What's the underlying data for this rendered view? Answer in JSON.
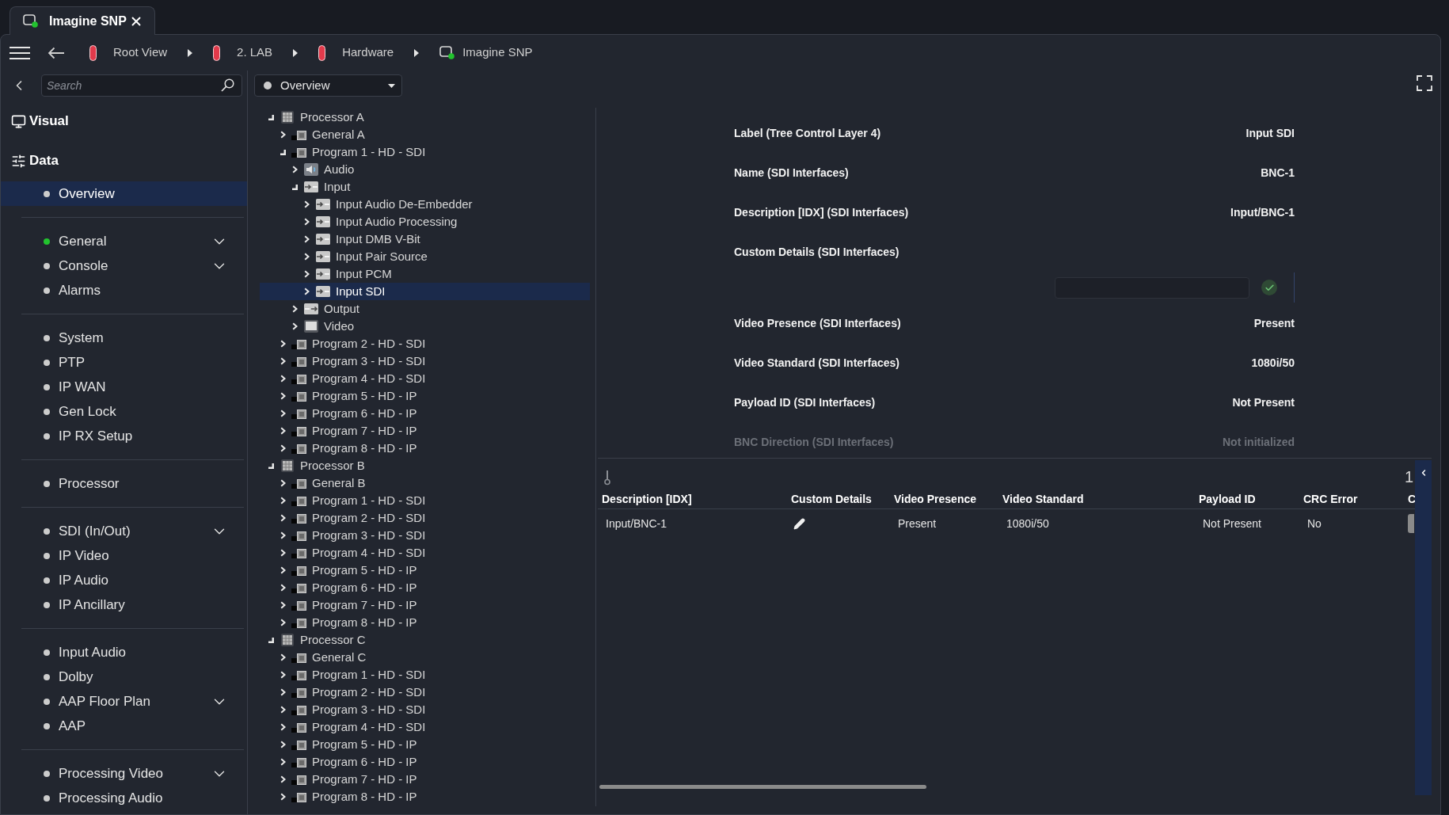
{
  "tabs": [
    {
      "title": "Imagine SNP",
      "selected": true
    }
  ],
  "breadcrumbs": [
    {
      "label": "Root View",
      "kind": "folder"
    },
    {
      "label": "2. LAB",
      "kind": "folder"
    },
    {
      "label": "Hardware",
      "kind": "folder"
    },
    {
      "label": "Imagine SNP",
      "kind": "device"
    }
  ],
  "search": {
    "placeholder": "Search"
  },
  "view_select": {
    "value": "Overview"
  },
  "sidebar": {
    "sections": [
      {
        "label": "Visual",
        "kind": "visual"
      },
      {
        "label": "Data",
        "kind": "data"
      }
    ],
    "groups": [
      {
        "items": [
          {
            "label": "Overview",
            "color": "#cccccc",
            "selected": true,
            "submenu": false
          }
        ]
      },
      {
        "items": [
          {
            "label": "General",
            "color": "#22c32e",
            "selected": false,
            "submenu": true
          },
          {
            "label": "Console",
            "color": "#cccccc",
            "selected": false,
            "submenu": true
          },
          {
            "label": "Alarms",
            "color": "#cccccc",
            "selected": false,
            "submenu": false
          }
        ]
      },
      {
        "items": [
          {
            "label": "System",
            "color": "#cccccc",
            "selected": false,
            "submenu": false
          },
          {
            "label": "PTP",
            "color": "#cccccc",
            "selected": false,
            "submenu": false
          },
          {
            "label": "IP WAN",
            "color": "#cccccc",
            "selected": false,
            "submenu": false
          },
          {
            "label": "Gen Lock",
            "color": "#cccccc",
            "selected": false,
            "submenu": false
          },
          {
            "label": "IP RX Setup",
            "color": "#cccccc",
            "selected": false,
            "submenu": false
          }
        ]
      },
      {
        "items": [
          {
            "label": "Processor",
            "color": "#cccccc",
            "selected": false,
            "submenu": false
          }
        ]
      },
      {
        "items": [
          {
            "label": "SDI (In/Out)",
            "color": "#cccccc",
            "selected": false,
            "submenu": true
          },
          {
            "label": "IP Video",
            "color": "#cccccc",
            "selected": false,
            "submenu": false
          },
          {
            "label": "IP Audio",
            "color": "#cccccc",
            "selected": false,
            "submenu": false
          },
          {
            "label": "IP Ancillary",
            "color": "#cccccc",
            "selected": false,
            "submenu": false
          }
        ]
      },
      {
        "items": [
          {
            "label": "Input Audio",
            "color": "#cccccc",
            "selected": false,
            "submenu": false
          },
          {
            "label": "Dolby",
            "color": "#cccccc",
            "selected": false,
            "submenu": false
          },
          {
            "label": "AAP Floor Plan",
            "color": "#cccccc",
            "selected": false,
            "submenu": true
          },
          {
            "label": "AAP",
            "color": "#cccccc",
            "selected": false,
            "submenu": false
          }
        ]
      },
      {
        "items": [
          {
            "label": "Processing Video",
            "color": "#cccccc",
            "selected": false,
            "submenu": true
          },
          {
            "label": "Processing Audio",
            "color": "#cccccc",
            "selected": false,
            "submenu": false
          }
        ]
      }
    ]
  },
  "tree": [
    {
      "label": "Processor A",
      "kind": "processor",
      "expanded": true,
      "selected": false,
      "children": [
        {
          "label": "General A",
          "kind": "module",
          "expanded": false,
          "selected": false
        },
        {
          "label": "Program 1 - HD - SDI",
          "kind": "module",
          "expanded": true,
          "selected": false,
          "children": [
            {
              "label": "Audio",
              "kind": "audio",
              "expanded": false,
              "selected": false
            },
            {
              "label": "Input",
              "kind": "input",
              "expanded": true,
              "selected": false,
              "children": [
                {
                  "label": "Input Audio De-Embedder",
                  "kind": "input",
                  "expanded": false,
                  "selected": false
                },
                {
                  "label": "Input Audio Processing",
                  "kind": "input",
                  "expanded": false,
                  "selected": false
                },
                {
                  "label": "Input DMB V-Bit",
                  "kind": "input",
                  "expanded": false,
                  "selected": false
                },
                {
                  "label": "Input Pair Source",
                  "kind": "input",
                  "expanded": false,
                  "selected": false
                },
                {
                  "label": "Input PCM",
                  "kind": "input",
                  "expanded": false,
                  "selected": false
                },
                {
                  "label": "Input SDI",
                  "kind": "input",
                  "expanded": false,
                  "selected": true
                }
              ]
            },
            {
              "label": "Output",
              "kind": "output",
              "expanded": false,
              "selected": false
            },
            {
              "label": "Video",
              "kind": "video",
              "expanded": false,
              "selected": false
            }
          ]
        },
        {
          "label": "Program 2 - HD - SDI",
          "kind": "module",
          "expanded": false,
          "selected": false
        },
        {
          "label": "Program 3 - HD - SDI",
          "kind": "module",
          "expanded": false,
          "selected": false
        },
        {
          "label": "Program 4 - HD - SDI",
          "kind": "module",
          "expanded": false,
          "selected": false
        },
        {
          "label": "Program 5 - HD - IP",
          "kind": "module",
          "expanded": false,
          "selected": false
        },
        {
          "label": "Program 6 - HD - IP",
          "kind": "module",
          "expanded": false,
          "selected": false
        },
        {
          "label": "Program 7 - HD - IP",
          "kind": "module",
          "expanded": false,
          "selected": false
        },
        {
          "label": "Program 8 - HD - IP",
          "kind": "module",
          "expanded": false,
          "selected": false
        }
      ]
    },
    {
      "label": "Processor B",
      "kind": "processor",
      "expanded": true,
      "selected": false,
      "children": [
        {
          "label": "General B",
          "kind": "module",
          "expanded": false,
          "selected": false
        },
        {
          "label": "Program 1 - HD - SDI",
          "kind": "module",
          "expanded": false,
          "selected": false
        },
        {
          "label": "Program 2 - HD - SDI",
          "kind": "module",
          "expanded": false,
          "selected": false
        },
        {
          "label": "Program 3 - HD - SDI",
          "kind": "module",
          "expanded": false,
          "selected": false
        },
        {
          "label": "Program 4 - HD - SDI",
          "kind": "module",
          "expanded": false,
          "selected": false
        },
        {
          "label": "Program 5 - HD - IP",
          "kind": "module",
          "expanded": false,
          "selected": false
        },
        {
          "label": "Program 6 - HD - IP",
          "kind": "module",
          "expanded": false,
          "selected": false
        },
        {
          "label": "Program 7 - HD - IP",
          "kind": "module",
          "expanded": false,
          "selected": false
        },
        {
          "label": "Program 8 - HD - IP",
          "kind": "module",
          "expanded": false,
          "selected": false
        }
      ]
    },
    {
      "label": "Processor C",
      "kind": "processor",
      "expanded": true,
      "selected": false,
      "children": [
        {
          "label": "General C",
          "kind": "module",
          "expanded": false,
          "selected": false
        },
        {
          "label": "Program 1 - HD - SDI",
          "kind": "module",
          "expanded": false,
          "selected": false
        },
        {
          "label": "Program 2 - HD - SDI",
          "kind": "module",
          "expanded": false,
          "selected": false
        },
        {
          "label": "Program 3 - HD - SDI",
          "kind": "module",
          "expanded": false,
          "selected": false
        },
        {
          "label": "Program 4 - HD - SDI",
          "kind": "module",
          "expanded": false,
          "selected": false
        },
        {
          "label": "Program 5 - HD - IP",
          "kind": "module",
          "expanded": false,
          "selected": false
        },
        {
          "label": "Program 6 - HD - IP",
          "kind": "module",
          "expanded": false,
          "selected": false
        },
        {
          "label": "Program 7 - HD - IP",
          "kind": "module",
          "expanded": false,
          "selected": false
        },
        {
          "label": "Program 8 - HD - IP",
          "kind": "module",
          "expanded": false,
          "selected": false
        }
      ]
    }
  ],
  "properties": [
    {
      "label": "Label (Tree Control Layer 4)",
      "value": "Input SDI",
      "kind": "text",
      "dimmed": false
    },
    {
      "label": "Name (SDI Interfaces)",
      "value": "BNC-1",
      "kind": "text",
      "dimmed": false
    },
    {
      "label": "Description [IDX] (SDI Interfaces)",
      "value": "Input/BNC-1",
      "kind": "text",
      "dimmed": false
    },
    {
      "label": "Custom Details (SDI Interfaces)",
      "kind": "editor",
      "dimmed": false
    },
    {
      "label": "Video Presence (SDI Interfaces)",
      "value": "Present",
      "kind": "text",
      "dimmed": false
    },
    {
      "label": "Video Standard (SDI Interfaces)",
      "value": "1080i/50",
      "kind": "text",
      "dimmed": false
    },
    {
      "label": "Payload ID (SDI Interfaces)",
      "value": "Not Present",
      "kind": "text",
      "dimmed": false
    },
    {
      "label": "BNC Direction (SDI Interfaces)",
      "value": "Not initialized",
      "kind": "text",
      "dimmed": true
    }
  ],
  "table": {
    "counter": "1",
    "columns": [
      "Description [IDX]",
      "Custom Details",
      "Video Presence",
      "Video Standard",
      "Payload ID",
      "CRC Error",
      "C"
    ],
    "rows": [
      {
        "cells": [
          {
            "kind": "text",
            "text": "Input/BNC-1"
          },
          {
            "kind": "edit"
          },
          {
            "kind": "text",
            "text": "Present"
          },
          {
            "kind": "text",
            "text": "1080i/50"
          },
          {
            "kind": "text",
            "text": "Not Present"
          },
          {
            "kind": "text",
            "text": "No"
          },
          {
            "kind": "control"
          }
        ]
      }
    ]
  }
}
